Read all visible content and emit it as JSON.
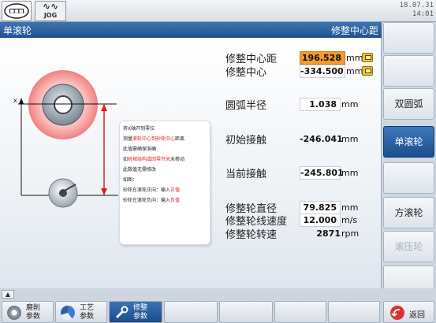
{
  "topbar": {
    "date": "18.07.31",
    "time": "14:01",
    "mode": "JOG",
    "logo_icon": "company-logo-icon"
  },
  "title": {
    "left": "单滚轮",
    "right": "修整中心距"
  },
  "params": {
    "center_distance_label": "修整中心距",
    "center_distance_value": "196.528",
    "center_distance_unit": "mm",
    "dress_center_label": "修整中心",
    "dress_center_value": "-334.500",
    "dress_center_unit": "mm",
    "arc_radius_label": "圆弧半径",
    "arc_radius_value": "1.038",
    "arc_radius_unit": "mm",
    "initial_contact_label": "初始接触",
    "initial_contact_value": "-246.041",
    "initial_contact_unit": "mm",
    "current_contact_label": "当前接触",
    "current_contact_value": "-245.801",
    "current_contact_unit": "mm",
    "wheel_diameter_label": "修整轮直径",
    "wheel_diameter_value": "79.825",
    "wheel_diameter_unit": "mm",
    "line_speed_label": "修整轮线速度",
    "line_speed_value": "12.000",
    "line_speed_unit": "m/s",
    "rpm_label": "修整轮转速",
    "rpm_value": "2871",
    "rpm_unit": "rpm"
  },
  "note": {
    "l1": "将X轴开到零位",
    "l2a": "测量",
    "l2b": "滚轮中心到砂轮中心",
    "l2c": "距离",
    "l3": "此值需确保准确",
    "l4a": "如",
    "l4b": "机械结构或回零开关",
    "l4c": "未移动",
    "l5": "此数值无需修改",
    "l6": "如图：",
    "l7a": "砂轮在滚轮正向：输入",
    "l7b": "正值",
    "l8a": "砂轮在滚轮负向：输入",
    "l8b": "负值"
  },
  "diagram": {
    "axis_x": "x"
  },
  "softkeys": [
    "",
    "",
    "双圆弧",
    "单滚轮",
    "",
    "方滚轮",
    "滚压轮",
    ""
  ],
  "softkey_active_index": 3,
  "softkey_disabled_index": 6,
  "bottom": {
    "grind_params": [
      "磨削",
      "参数"
    ],
    "process_params": [
      "工艺",
      "参数"
    ],
    "dress_params": [
      "修整",
      "参数"
    ],
    "back": "返回",
    "colors": {
      "accent": "#1e5292",
      "highlight": "#f29a2e",
      "warn": "#e02020"
    }
  }
}
